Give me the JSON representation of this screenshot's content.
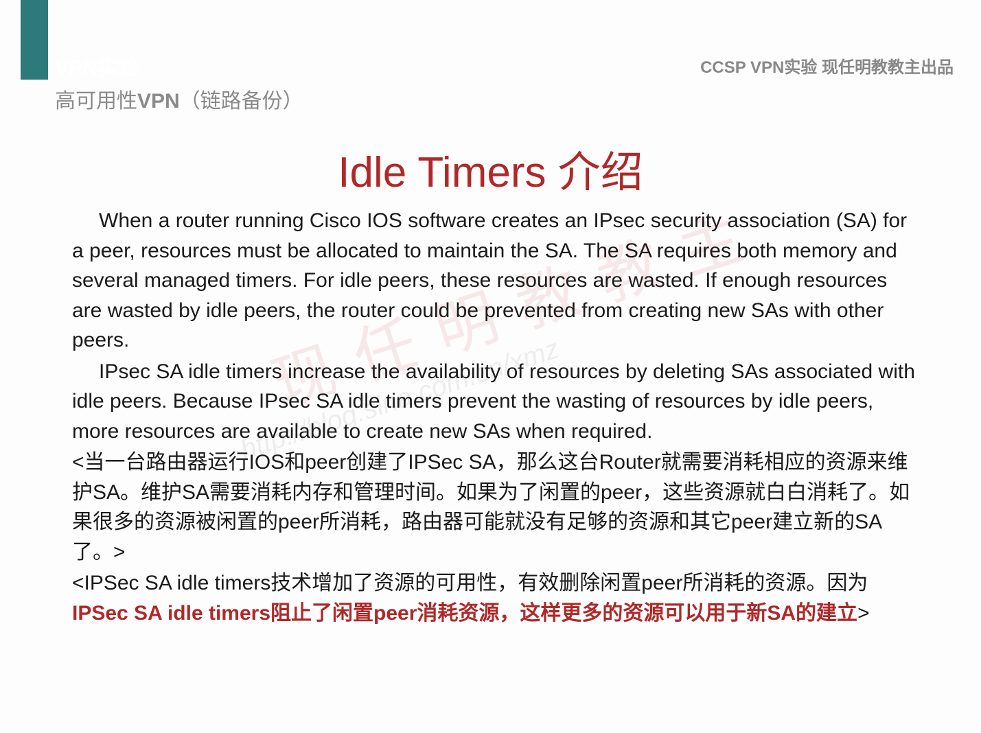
{
  "header": {
    "left_title": "VPN实验",
    "right_text": "CCSP VPN实验 现任明教教主出品",
    "subtitle_prefix": "高可用性",
    "subtitle_bold": "VPN",
    "subtitle_suffix": "（链路备份）"
  },
  "title": "Idle Timers 介绍",
  "paragraphs": {
    "en1": "When a router running Cisco IOS software creates an IPsec security association (SA) for a peer, resources must be allocated to maintain the SA. The SA requires both memory and several managed timers. For idle peers, these resources are wasted. If enough resources are wasted by idle peers, the router could be prevented from creating new SAs with other peers.",
    "en2": "IPsec SA idle timers increase the availability of resources by deleting SAs associated with idle peers. Because IPsec SA idle timers prevent the wasting of resources by idle peers, more resources are available to create new SAs when required.",
    "cn1": "<当一台路由器运行IOS和peer创建了IPSec SA，那么这台Router就需要消耗相应的资源来维护SA。维护SA需要消耗内存和管理时间。如果为了闲置的peer，这些资源就白白消耗了。如果很多的资源被闲置的peer所消耗，路由器可能就没有足够的资源和其它peer建立新的SA了。>",
    "cn2_a": "<IPSec SA idle timers技术增加了资源的可用性，有效删除闲置peer所消耗的资源。因为",
    "cn2_emph": "IPSec SA idle timers阻止了闲置peer消耗资源，这样更多的资源可以用于新SA的建立",
    "cn2_b": ">"
  },
  "watermark": {
    "main": "现 任 明 教 教 主",
    "url": "http://blog.sina.com.cn/xmz"
  }
}
